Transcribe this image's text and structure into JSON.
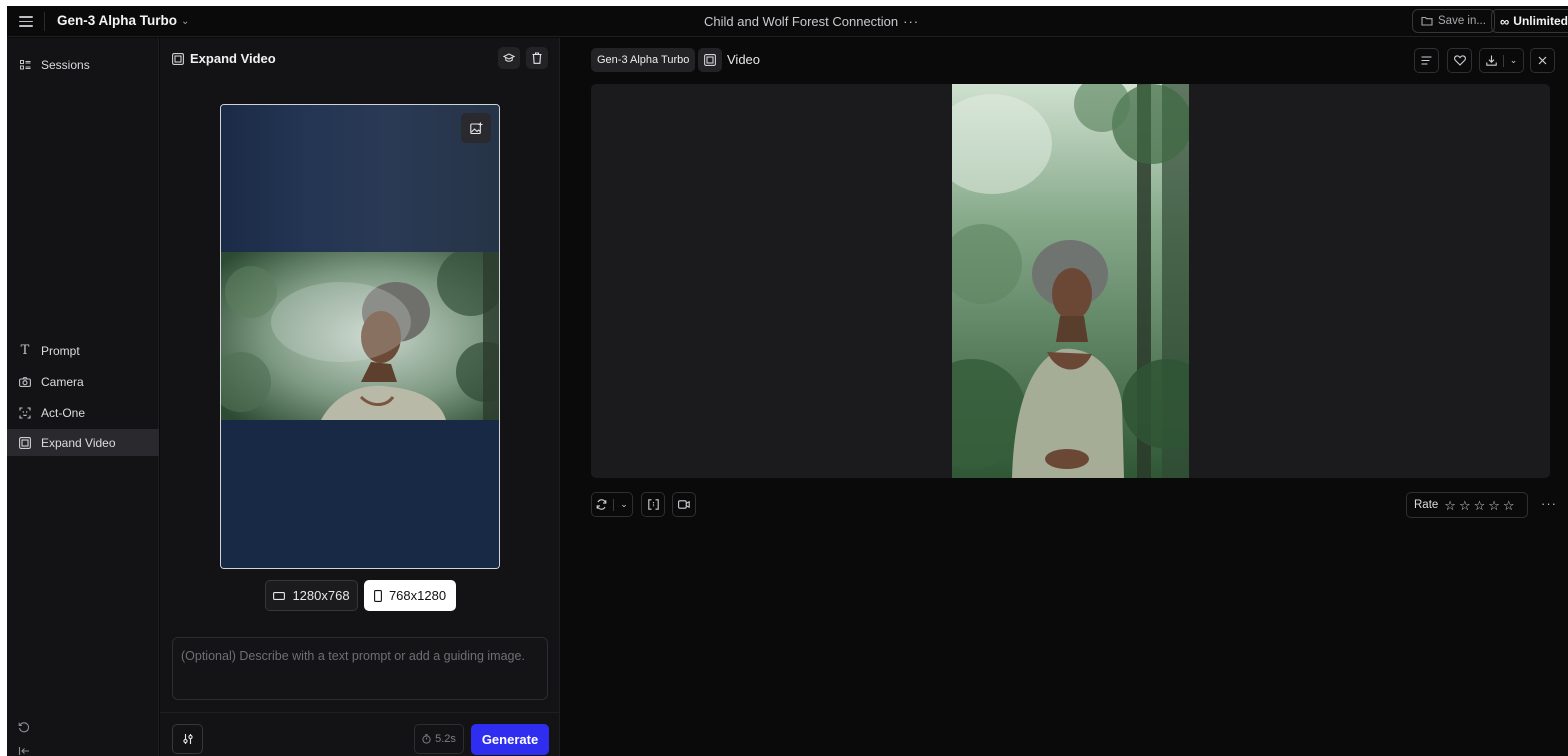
{
  "topbar": {
    "model_name": "Gen-3 Alpha Turbo",
    "session_title": "Child and Wolf Forest Connection",
    "title_more": "···",
    "save_label": "Save in...",
    "plan_label": "Unlimited"
  },
  "sidebar": {
    "sessions_label": "Sessions",
    "items": [
      {
        "label": "Prompt",
        "icon": "text-icon"
      },
      {
        "label": "Camera",
        "icon": "camera-icon"
      },
      {
        "label": "Act-One",
        "icon": "face-scan-icon"
      },
      {
        "label": "Expand Video",
        "icon": "expand-video-icon",
        "active": true
      }
    ]
  },
  "panel": {
    "title": "Expand Video",
    "ratios": [
      {
        "label": "1280x768",
        "selected": false
      },
      {
        "label": "768x1280",
        "selected": true
      }
    ],
    "prompt_placeholder": "(Optional) Describe with a text prompt or add a guiding image.",
    "duration": "5.2s",
    "generate_label": "Generate"
  },
  "main": {
    "model_chip": "Gen-3 Alpha Turbo",
    "video_label": "Video",
    "rate_label": "Rate",
    "rating": 0,
    "rating_max": 5
  },
  "colors": {
    "accent": "#2f2ef0",
    "background": "#0a0a0b",
    "panel": "#131315"
  }
}
